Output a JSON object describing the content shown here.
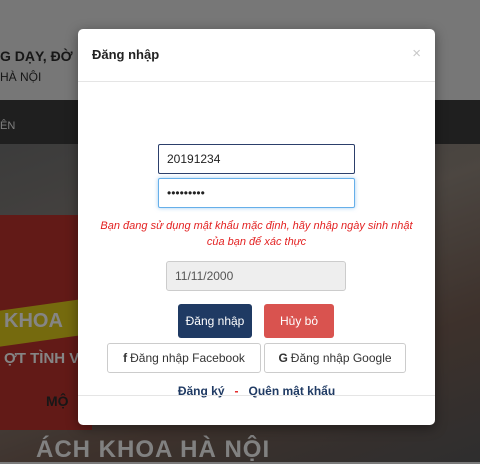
{
  "background": {
    "header_line1": "G DẠY, ĐỜ",
    "header_line2": "HÀ NỘI",
    "nav_text": "ÊN",
    "hero_text1": "KHOA",
    "hero_text2": "ỢT TÌNH V",
    "hero_text3": "MỘ",
    "bottom_text": "ÁCH KHOA HÀ NỘI"
  },
  "modal": {
    "title": "Đăng nhập",
    "close_symbol": "×",
    "username_value": "20191234",
    "password_value": "•••••••••",
    "warning": "Bạn đang sử dụng mật khẩu mặc định, hãy nhập ngày sinh nhật của bạn để xác thực",
    "birthday_value": "11/11/2000",
    "login_button": "Đăng nhập",
    "cancel_button": "Hủy bỏ",
    "facebook_icon": "f",
    "facebook_button": "Đăng nhập Facebook",
    "google_icon": "G",
    "google_button": "Đăng nhập Google",
    "register_link": "Đăng ký",
    "separator": "-",
    "forgot_link": "Quên mật khẩu"
  },
  "colors": {
    "primary": "#1f3a63",
    "danger": "#d9534f",
    "warning_text": "#e32222"
  }
}
